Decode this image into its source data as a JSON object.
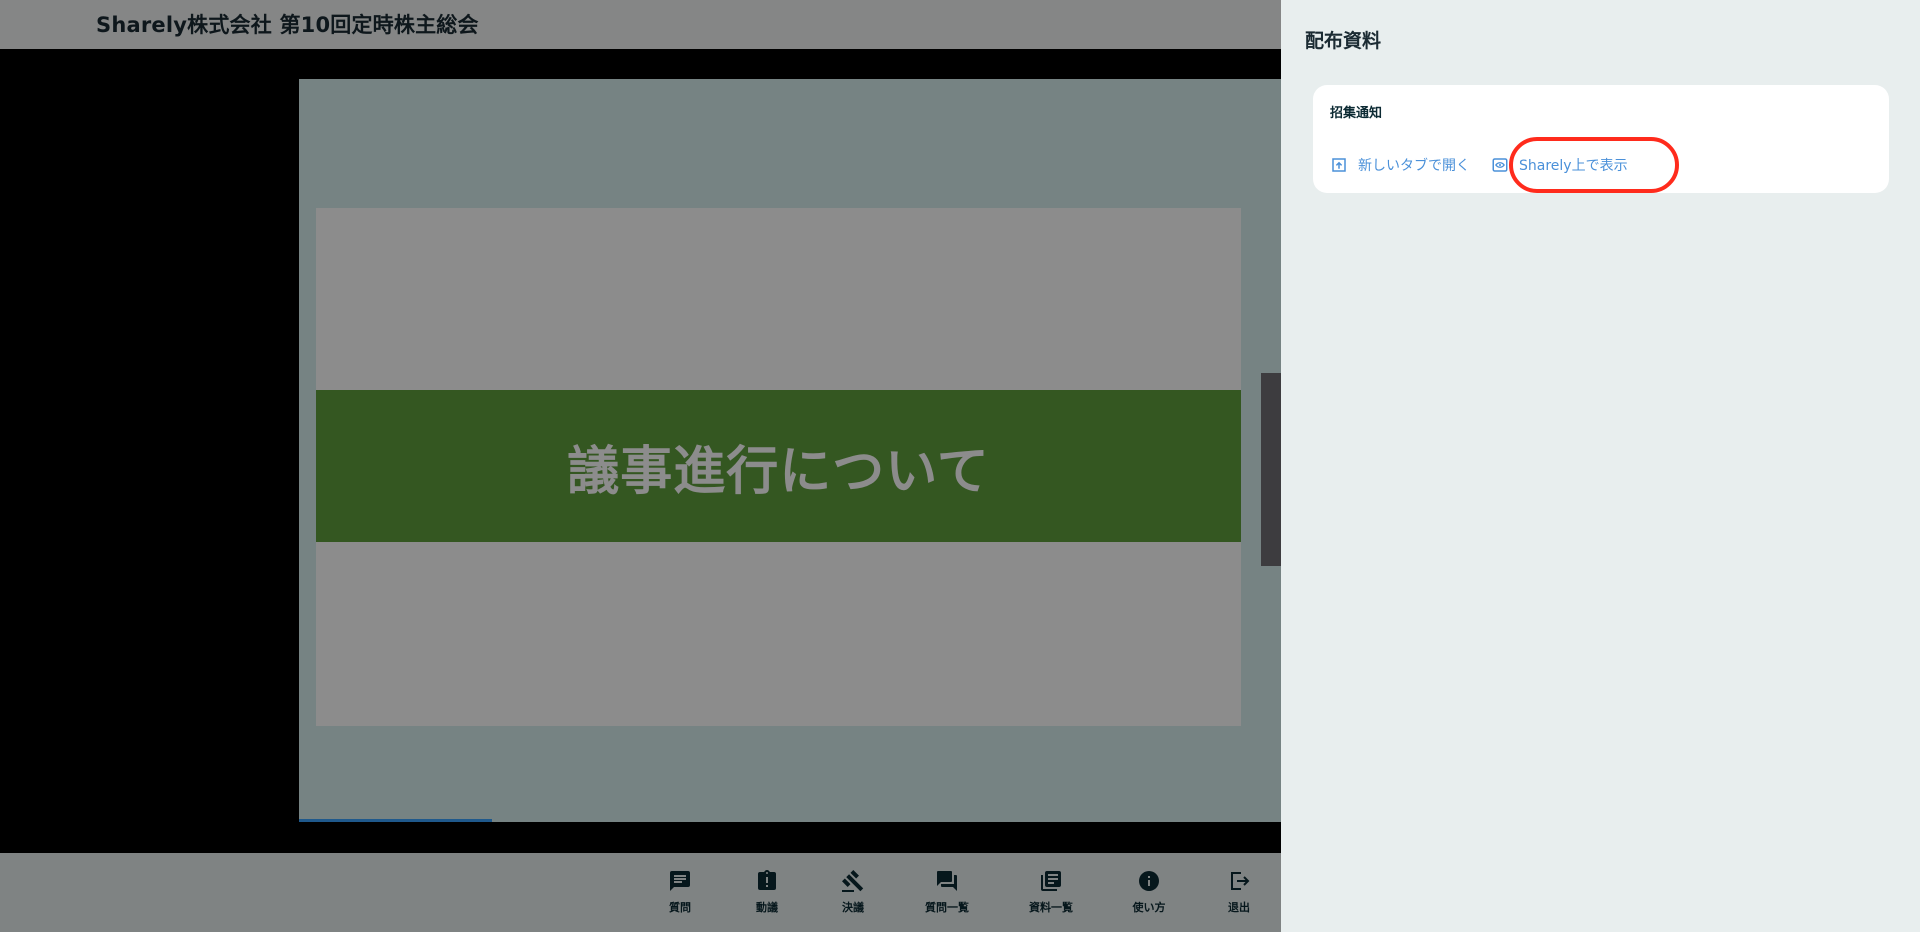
{
  "header": {
    "title": "Sharely株式会社 第10回定時株主総会"
  },
  "slide": {
    "banner_text": "議事進行について"
  },
  "nav": {
    "items": [
      {
        "label": "質問",
        "icon": "message-icon"
      },
      {
        "label": "動議",
        "icon": "clipboard-alert-icon"
      },
      {
        "label": "決議",
        "icon": "gavel-icon"
      },
      {
        "label": "質問一覧",
        "icon": "forum-icon"
      },
      {
        "label": "資料一覧",
        "icon": "library-icon"
      },
      {
        "label": "使い方",
        "icon": "info-icon"
      },
      {
        "label": "退出",
        "icon": "logout-icon"
      }
    ]
  },
  "drawer": {
    "title": "配布資料",
    "documents": [
      {
        "name": "招集通知",
        "open_new_tab_label": "新しいタブで開く",
        "view_on_sharely_label": "Sharely上で表示"
      }
    ]
  },
  "colors": {
    "link": "#4a90d9",
    "banner_green": "#5f9f3c",
    "highlight": "#ff2b1c",
    "drawer_bg": "#e8eeee"
  }
}
